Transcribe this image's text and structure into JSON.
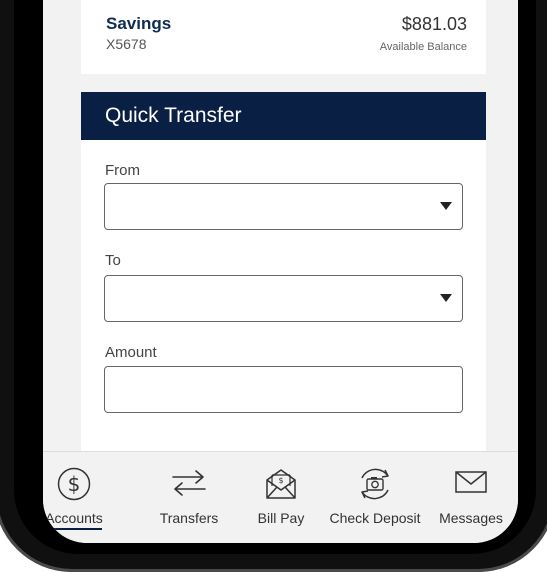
{
  "account": {
    "name": "Savings",
    "number": "X5678",
    "balance": "$881.03",
    "balance_label": "Available Balance"
  },
  "quick_transfer": {
    "title": "Quick Transfer",
    "from_label": "From",
    "from_value": "",
    "to_label": "To",
    "to_value": "",
    "amount_label": "Amount",
    "amount_value": ""
  },
  "nav": {
    "items": [
      {
        "label": "Accounts",
        "icon": "dollar-circle-icon",
        "active": true
      },
      {
        "label": "Transfers",
        "icon": "transfer-arrows-icon"
      },
      {
        "label": "Bill Pay",
        "icon": "bill-envelope-icon"
      },
      {
        "label": "Check Deposit",
        "icon": "camera-refresh-icon"
      },
      {
        "label": "Messages",
        "icon": "envelope-icon"
      }
    ]
  },
  "colors": {
    "primary": "#0a1f44",
    "account_name": "#0f2d52",
    "screen_bg": "#f2f2f2"
  }
}
